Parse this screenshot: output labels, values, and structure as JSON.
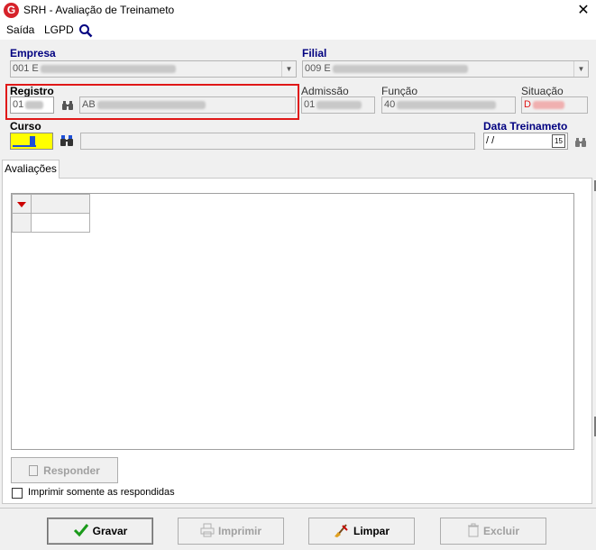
{
  "window": {
    "icon_letter": "G",
    "title": "SRH - Avaliação de Treinameto",
    "close": "✕"
  },
  "menu": {
    "items": [
      "Saída",
      "LGPD"
    ]
  },
  "form": {
    "empresa": {
      "label": "Empresa",
      "value": "001 E"
    },
    "filial": {
      "label": "Filial",
      "value": "009 E"
    },
    "registro": {
      "label": "Registro",
      "code": "01",
      "name": "AB"
    },
    "admissao": {
      "label": "Admissão",
      "value": "01"
    },
    "funcao": {
      "label": "Função",
      "value": "40"
    },
    "situacao": {
      "label": "Situação",
      "value": "D",
      "color": "#e01818"
    },
    "curso": {
      "label": "Curso"
    },
    "data_treinamento": {
      "label": "Data Treinameto",
      "value": " / /",
      "calendar": "15"
    }
  },
  "tabs": [
    {
      "label": "Avaliações"
    }
  ],
  "grid": {
    "indicator_color": "#cc0000"
  },
  "responder_button": {
    "label": "Responder"
  },
  "checkbox": {
    "label": "Imprimir somente as respondidas",
    "checked": false
  },
  "footer": {
    "gravar": "Gravar",
    "imprimir": "Imprimir",
    "limpar": "Limpar",
    "excluir": "Excluir"
  }
}
